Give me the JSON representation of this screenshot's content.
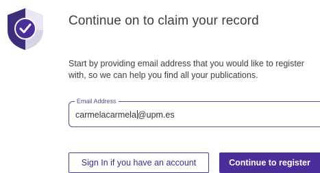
{
  "header": {
    "title": "Continue on to claim your record",
    "logo_icon": "shield-check-icon"
  },
  "description": "Start by providing email address that you would like to register with, so we can help you find all your publications.",
  "email_field": {
    "label": "Email Address",
    "value_before_caret": "carmelacarmela",
    "value_after_caret": "@upm.es"
  },
  "buttons": {
    "sign_in": "Sign In if you have an account",
    "continue": "Continue to register"
  },
  "colors": {
    "primary": "#4a2f9a",
    "outline": "#4a3c96",
    "shield_dark": "#3e2c7c",
    "shield_light": "#d9d3ea"
  }
}
